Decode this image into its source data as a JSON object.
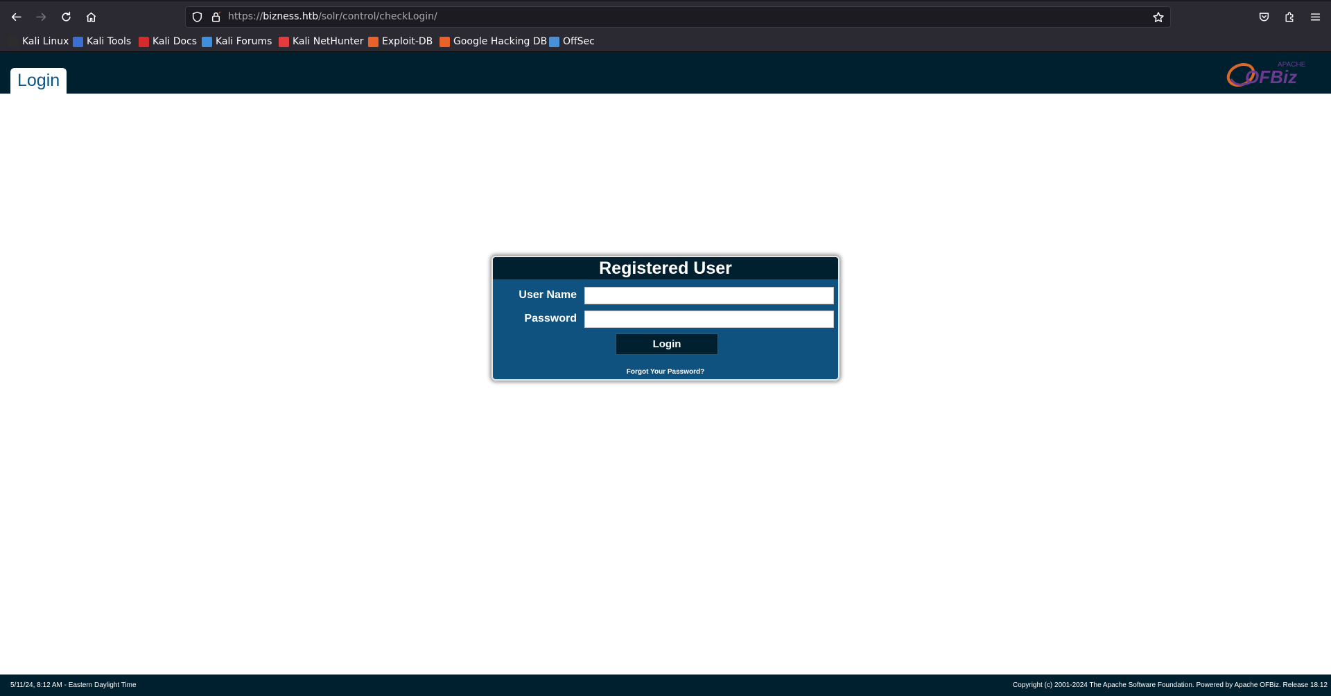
{
  "browser": {
    "url_prefix": "https://",
    "url_host": "bizness.htb",
    "url_path": "/solr/control/checkLogin/",
    "bookmarks": [
      {
        "label": "Kali Linux",
        "icon": "kali-dragon-icon",
        "color": "#2d2d2d"
      },
      {
        "label": "Kali Tools",
        "icon": "kali-tools-icon",
        "color": "#3b6fd4"
      },
      {
        "label": "Kali Docs",
        "icon": "kali-docs-icon",
        "color": "#d62b2b"
      },
      {
        "label": "Kali Forums",
        "icon": "kali-forums-icon",
        "color": "#3f8fe0"
      },
      {
        "label": "Kali NetHunter",
        "icon": "nethunter-icon",
        "color": "#e23c3c"
      },
      {
        "label": "Exploit-DB",
        "icon": "exploit-db-icon",
        "color": "#e8622a"
      },
      {
        "label": "Google Hacking DB",
        "icon": "ghdb-icon",
        "color": "#e8622a"
      },
      {
        "label": "OffSec",
        "icon": "offsec-icon",
        "color": "#4a90d9"
      }
    ]
  },
  "header": {
    "tab_title": "Login",
    "logo": {
      "apache": "APACHE",
      "name": "OFBiz"
    }
  },
  "login": {
    "title": "Registered User",
    "username_label": "User Name",
    "password_label": "Password",
    "username_value": "",
    "password_value": "",
    "button_label": "Login",
    "forgot_label": "Forgot Your Password?"
  },
  "footer": {
    "left": "5/11/24, 8:12 AM - Eastern Daylight Time",
    "right": "Copyright (c) 2001-2024 The Apache Software Foundation. Powered by Apache OFBiz. Release 18.12"
  },
  "colors": {
    "header_bg": "#002030",
    "login_body_bg": "#0f5280",
    "title_text": "#0a5584"
  }
}
